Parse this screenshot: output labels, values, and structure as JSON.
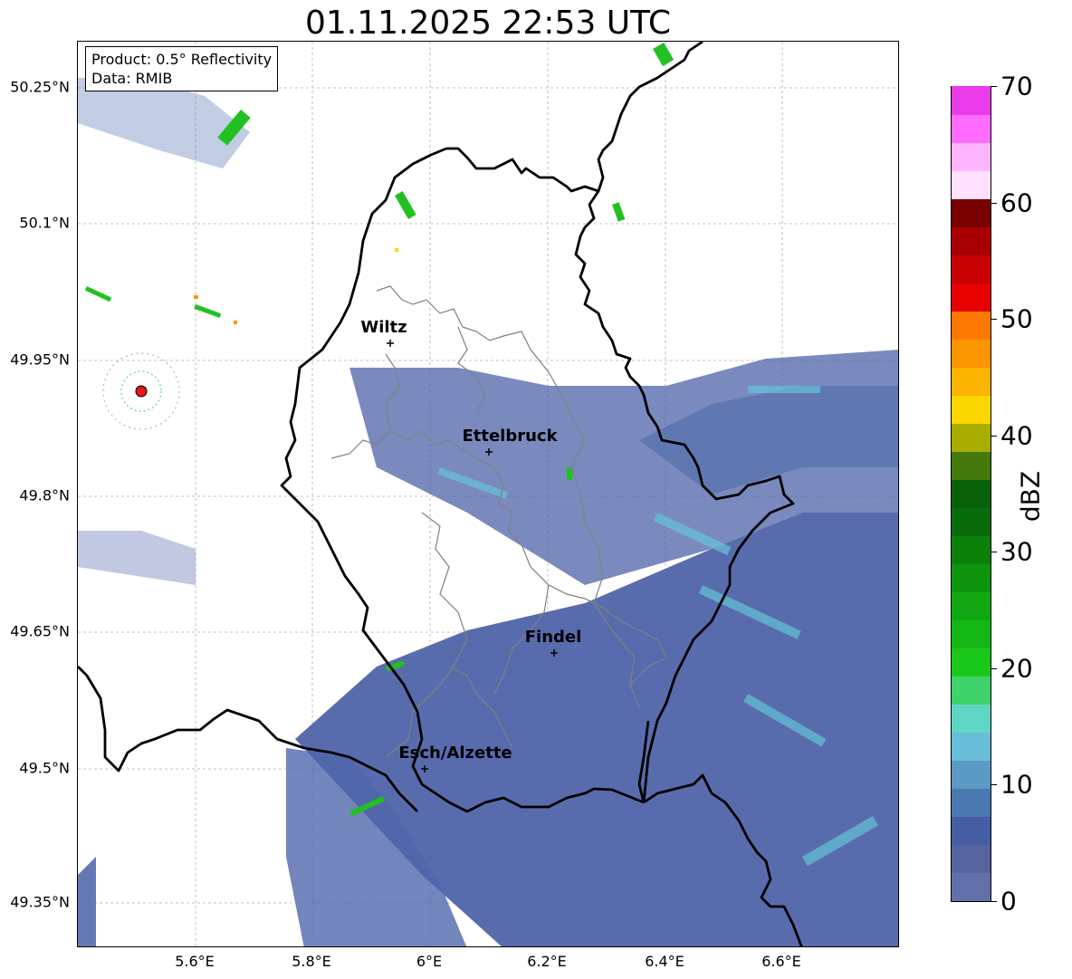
{
  "title": "01.11.2025 22:53 UTC",
  "info_box": {
    "product": "Product: 0.5° Reflectivity",
    "source": "Data: RMIB"
  },
  "lat_labels": [
    "50.25°N",
    "50.1°N",
    "49.95°N",
    "49.8°N",
    "49.65°N",
    "49.5°N",
    "49.35°N"
  ],
  "lon_labels": [
    "5.6°E",
    "5.8°E",
    "6°E",
    "6.2°E",
    "6.4°E",
    "6.6°E"
  ],
  "cities": [
    {
      "name": "Wiltz"
    },
    {
      "name": "Ettelbruck"
    },
    {
      "name": "Findel"
    },
    {
      "name": "Esch/Alzette"
    }
  ],
  "colorbar": {
    "unit": "dBZ",
    "min": 0,
    "max": 70,
    "tick_labels": [
      "0",
      "10",
      "20",
      "30",
      "40",
      "50",
      "60",
      "70"
    ],
    "colors": [
      "#6170a8",
      "#56659f",
      "#465ea3",
      "#4a79b1",
      "#5b9ac5",
      "#68bdd8",
      "#5fd6c4",
      "#3fd26a",
      "#1ac81a",
      "#14b814",
      "#12a812",
      "#0e950e",
      "#0b800b",
      "#0a6b0a",
      "#086008",
      "#457a0b",
      "#a9ad00",
      "#fcd600",
      "#fcb400",
      "#fc9500",
      "#fc7800",
      "#e60000",
      "#c80000",
      "#a80000",
      "#7a0000",
      "#ffe0ff",
      "#ffb4ff",
      "#ff6cff",
      "#e93be9"
    ]
  },
  "radar_site_color": "#e31a1c",
  "background_echo_color": "#4a5fa6"
}
